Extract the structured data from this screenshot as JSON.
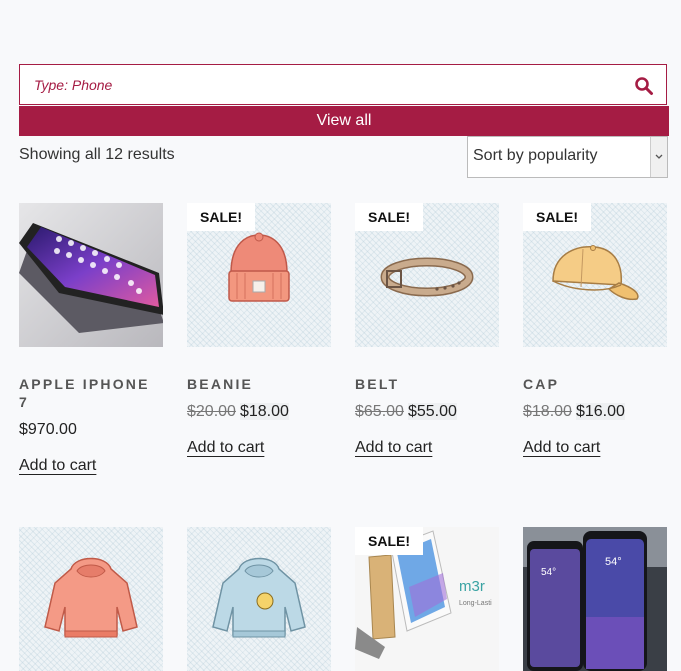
{
  "search": {
    "placeholder": "Type: Phone",
    "value": ""
  },
  "view_all_label": "View all",
  "results_text": "Showing all 12 results",
  "sort": {
    "selected": "Sort by popularity"
  },
  "products": [
    {
      "name": "APPLE IPHONE 7",
      "price": "$970.00",
      "add_to_cart": "Add to cart",
      "image_icon": "iphone-image"
    },
    {
      "name": "BEANIE",
      "old_price": "$20.00",
      "price": "$18.00",
      "sale_badge": "SALE!",
      "add_to_cart": "Add to cart",
      "image_icon": "beanie-image"
    },
    {
      "name": "BELT",
      "old_price": "$65.00",
      "price": "$55.00",
      "sale_badge": "SALE!",
      "add_to_cart": "Add to cart",
      "image_icon": "belt-image"
    },
    {
      "name": "CAP",
      "old_price": "$18.00",
      "price": "$16.00",
      "sale_badge": "SALE!",
      "add_to_cart": "Add to cart",
      "image_icon": "cap-image"
    },
    {
      "image_icon": "hoodie-orange-image"
    },
    {
      "image_icon": "hoodie-blue-image"
    },
    {
      "sale_badge": "SALE!",
      "image_icon": "phone-m3-image",
      "image_text": "m3r",
      "image_subtext": "Long-Lasti"
    },
    {
      "image_icon": "galaxy-phones-image",
      "image_text_1": "54°",
      "image_text_2": "54°"
    }
  ],
  "colors": {
    "accent": "#a51c44",
    "background": "#f8f9fb"
  }
}
